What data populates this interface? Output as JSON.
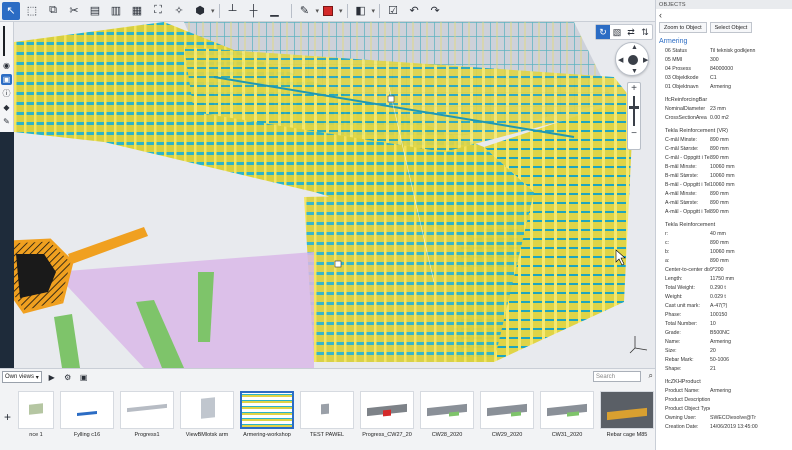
{
  "toolbar": {
    "buttons": [
      "select-tool",
      "box-select",
      "area-select",
      "clip-tool",
      "view-a",
      "view-b",
      "view-c",
      "fit-all",
      "measure",
      "cube",
      "dims-a",
      "dims-b",
      "dims-c",
      "pen",
      "color",
      "layout",
      "settings",
      "undo",
      "redo"
    ],
    "color_swatch": "#d42a2a"
  },
  "colors": {
    "accent": "#2b6cc4",
    "rebar_yellow": "#e8d84a",
    "rebar_cyan": "#2bb3c9",
    "hatch_orange": "#f0a020",
    "slab_purple": "#d9b9e8",
    "support_green": "#7ec46a"
  },
  "views": {
    "dropdown": "Own views",
    "search_placeholder": "Search",
    "items": [
      {
        "label": "nce 1"
      },
      {
        "label": "Fylling c16"
      },
      {
        "label": "Progress1"
      },
      {
        "label": "ViewBMlotsk arm"
      },
      {
        "label": "Armering-workshop",
        "selected": true
      },
      {
        "label": "TEST PAWEL"
      },
      {
        "label": "Progress_CW27_20"
      },
      {
        "label": "CW28_2020"
      },
      {
        "label": "CW29_2020"
      },
      {
        "label": "CW31_2020"
      },
      {
        "label": "Rebar cage M85"
      }
    ]
  },
  "panel": {
    "header": "OBJECTS",
    "zoom_button": "Zoom to Object",
    "select_button": "Select Object",
    "title": "Armering",
    "general": [
      {
        "k": "06 Status",
        "v": "Til teknisk godkjenn"
      },
      {
        "k": "05 MMI",
        "v": "300"
      },
      {
        "k": "04 Prosess",
        "v": "84000000"
      },
      {
        "k": "03 Objektkode",
        "v": "C1"
      },
      {
        "k": "01 Objektnavn",
        "v": "Armering"
      }
    ],
    "section_ifc": "IfcReinforcingBar",
    "ifc": [
      {
        "k": "NominalDiameter",
        "v": "23 mm"
      },
      {
        "k": "CrossSectionArea",
        "v": "0.00 m2"
      }
    ],
    "section_vr": "Tekla Reinforcement (VR)",
    "vr": [
      {
        "k": "C-mål Minste:",
        "v": "890 mm"
      },
      {
        "k": "C-mål Største:",
        "v": "890 mm"
      },
      {
        "k": "C-mål - Oppgitt i Tekla Reinforc",
        "v": "890 mm"
      },
      {
        "k": "B-mål Minste:",
        "v": "10060 mm"
      },
      {
        "k": "B-mål Største:",
        "v": "10060 mm"
      },
      {
        "k": "B-mål - Oppgitt i Tekla Reinforc",
        "v": "10060 mm"
      },
      {
        "k": "A-mål Minste:",
        "v": "890 mm"
      },
      {
        "k": "A-mål Største:",
        "v": "890 mm"
      },
      {
        "k": "A-mål - Oppgitt i Tekla Reinforc",
        "v": "890 mm"
      }
    ],
    "section_tr": "Tekla Reinforcement",
    "tr": [
      {
        "k": "r:",
        "v": "40 mm"
      },
      {
        "k": "c:",
        "v": "890 mm"
      },
      {
        "k": "b:",
        "v": "10060 mm"
      },
      {
        "k": "a:",
        "v": "890 mm"
      },
      {
        "k": "Center-to-center distance:",
        "v": "9*200"
      },
      {
        "k": "Length:",
        "v": "11750 mm"
      },
      {
        "k": "Total Weight:",
        "v": "0.290 t"
      },
      {
        "k": "Weight:",
        "v": "0.029 t"
      },
      {
        "k": "Cast unit mark:",
        "v": "A-47(?)"
      },
      {
        "k": "Phase:",
        "v": "100150"
      },
      {
        "k": "Total Number:",
        "v": "10"
      },
      {
        "k": "Grade:",
        "v": "B500NC"
      },
      {
        "k": "Name:",
        "v": "Armering"
      },
      {
        "k": "Size:",
        "v": "20"
      },
      {
        "k": "Rebar Mark:",
        "v": "50-1006"
      },
      {
        "k": "Shape:",
        "v": "21"
      }
    ],
    "section_product": "IfcZKHProduct",
    "product": [
      {
        "k": "Product Name:",
        "v": "Armering"
      },
      {
        "k": "Product Description:",
        "v": ""
      },
      {
        "k": "Product Object Type:",
        "v": ""
      },
      {
        "k": "Owning User:",
        "v": "SWECO\\esolve@Tr"
      },
      {
        "k": "Creation Date:",
        "v": "14/06/2019 13:45:00"
      }
    ]
  }
}
